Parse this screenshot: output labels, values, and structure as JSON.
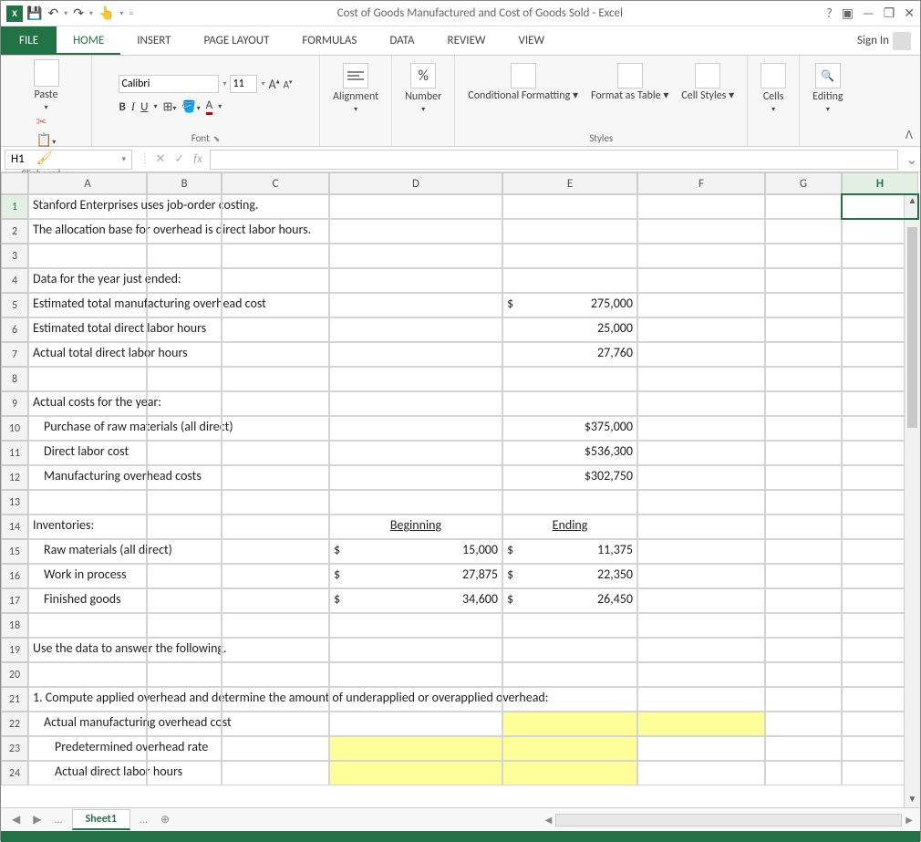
{
  "app": {
    "title": "Cost of Goods Manufactured and Cost of Goods Sold - Excel",
    "signin": "Sign In"
  },
  "qat": {
    "save": "💾",
    "undo": "↶",
    "redo": "↷",
    "touch": "👆"
  },
  "wincontrols": {
    "help": "?",
    "ribbonopts": "▣",
    "min": "—",
    "restore": "❐",
    "close": "✕"
  },
  "tabs": {
    "file": "FILE",
    "home": "HOME",
    "insert": "INSERT",
    "pagelayout": "PAGE LAYOUT",
    "formulas": "FORMULAS",
    "data": "DATA",
    "review": "REVIEW",
    "view": "VIEW"
  },
  "ribbon": {
    "clipboard": "Clipboard",
    "paste": "Paste",
    "font_group": "Font",
    "font_name": "Calibri",
    "font_size": "11",
    "bold": "B",
    "italic": "I",
    "underline": "U",
    "alignment": "Alignment",
    "number": "Number",
    "percent": "%",
    "styles": "Styles",
    "conditional": "Conditional Formatting",
    "formatas": "Format as Table",
    "cellstyles": "Cell Styles",
    "cells": "Cells",
    "editing": "Editing"
  },
  "namebox": "H1",
  "columns": [
    "A",
    "B",
    "C",
    "D",
    "E",
    "F",
    "G",
    "H"
  ],
  "rows": [
    {
      "n": 1,
      "A": "Stanford Enterprises uses job-order costing."
    },
    {
      "n": 2,
      "A": "The allocation base for overhead is direct labor hours."
    },
    {
      "n": 3
    },
    {
      "n": 4,
      "A": "Data for the year just ended:"
    },
    {
      "n": 5,
      "A": "Estimated total manufacturing overhead cost",
      "E": {
        "d": "$",
        "v": "275,000"
      }
    },
    {
      "n": 6,
      "A": "Estimated total direct labor hours",
      "E": {
        "r": "25,000"
      }
    },
    {
      "n": 7,
      "A": "Actual total direct labor hours",
      "E": {
        "r": "27,760"
      }
    },
    {
      "n": 8
    },
    {
      "n": 9,
      "A": "Actual costs for the year:"
    },
    {
      "n": 10,
      "A_indent": "Purchase of raw materials (all direct)",
      "E": {
        "r": "$375,000"
      }
    },
    {
      "n": 11,
      "A_indent": "Direct labor cost",
      "E": {
        "r": "$536,300"
      }
    },
    {
      "n": 12,
      "A_indent": "Manufacturing overhead costs",
      "E": {
        "r": "$302,750"
      }
    },
    {
      "n": 13
    },
    {
      "n": 14,
      "A": "Inventories:",
      "D": {
        "ul": "Beginning"
      },
      "E": {
        "ul": "Ending"
      }
    },
    {
      "n": 15,
      "A_indent": "Raw materials (all direct)",
      "D": {
        "d": "$",
        "v": "15,000"
      },
      "E": {
        "d": "$",
        "v": "11,375"
      }
    },
    {
      "n": 16,
      "A_indent": "Work in process",
      "D": {
        "d": "$",
        "v": "27,875"
      },
      "E": {
        "d": "$",
        "v": "22,350"
      }
    },
    {
      "n": 17,
      "A_indent": "Finished goods",
      "D": {
        "d": "$",
        "v": "34,600"
      },
      "E": {
        "d": "$",
        "v": "26,450"
      }
    },
    {
      "n": 18
    },
    {
      "n": 19,
      "A": "Use the data to answer the following."
    },
    {
      "n": 20
    },
    {
      "n": 21,
      "A": "1. Compute applied overhead and determine the amount of underapplied or overapplied overhead:"
    },
    {
      "n": 22,
      "A_indent": "Actual manufacturing overhead cost",
      "yellow": [
        "E",
        "F"
      ]
    },
    {
      "n": 23,
      "A_indent2": "Predetermined overhead rate",
      "yellow": [
        "D",
        "E"
      ]
    },
    {
      "n": 24,
      "A_indent2": "Actual direct labor hours",
      "yellow": [
        "D",
        "E"
      ]
    }
  ],
  "sheet": {
    "name": "Sheet1",
    "dots": "...",
    "plus": "⊕"
  }
}
